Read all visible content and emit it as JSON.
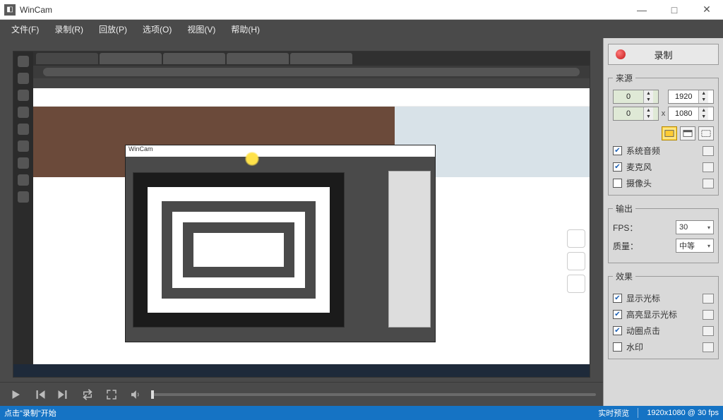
{
  "window": {
    "title": "WinCam"
  },
  "title_buttons": {
    "min": "—",
    "max": "□",
    "close": "✕"
  },
  "menu": {
    "file": "文件(F)",
    "record": "录制(R)",
    "replay": "回放(P)",
    "options": "选项(O)",
    "view": "视图(V)",
    "help": "帮助(H)"
  },
  "record_button": {
    "label": "录制"
  },
  "source": {
    "legend": "来源",
    "x0": "0",
    "y0": "0",
    "w": "1920",
    "h": "1080",
    "sep": "x",
    "checks": {
      "system_audio": {
        "label": "系统音频",
        "checked": true
      },
      "microphone": {
        "label": "麦克风",
        "checked": true
      },
      "camera": {
        "label": "摄像头",
        "checked": false
      }
    }
  },
  "output": {
    "legend": "输出",
    "fps_label": "FPS：",
    "fps_value": "30",
    "quality_label": "质量：",
    "quality_value": "中等"
  },
  "effects": {
    "legend": "效果",
    "show_cursor": {
      "label": "显示光标",
      "checked": true
    },
    "highlight_cursor": {
      "label": "高亮显示光标",
      "checked": true
    },
    "animate_click": {
      "label": "动圈点击",
      "checked": true
    },
    "watermark": {
      "label": "水印",
      "checked": false
    }
  },
  "status": {
    "left": "点击\"录制\"开始",
    "mid": "实时预览",
    "right": "1920x1080 @ 30 fps"
  },
  "nested_title": "WinCam"
}
